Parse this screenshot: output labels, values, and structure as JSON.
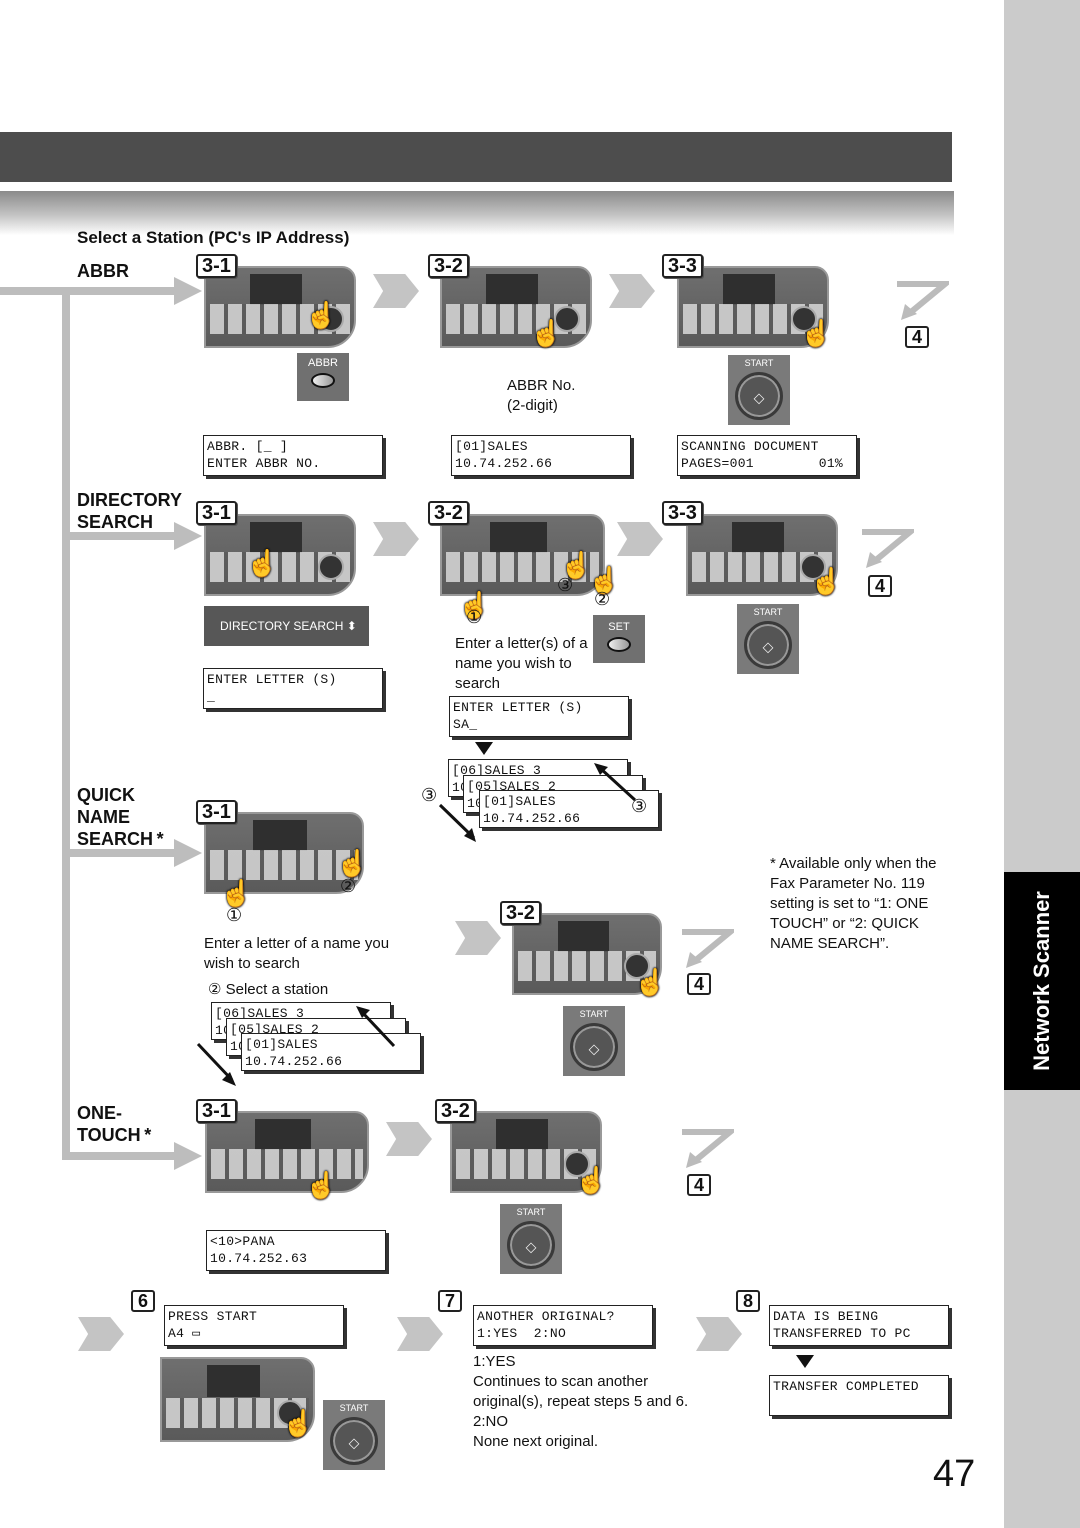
{
  "page": {
    "heading": "Select a Station (PC's IP Address)",
    "page_number": "47",
    "side_tab": "Network Scanner",
    "footnote": "* Available only when the Fax Parameter No. 119 setting is set to “1: ONE TOUCH” or “2: QUICK NAME SEARCH”."
  },
  "methods": {
    "abbr": {
      "label": "ABBR",
      "steps": [
        "3-1",
        "3-2",
        "3-3"
      ],
      "abbr_key": "ABBR",
      "abbr_no_caption": [
        "ABBR No.",
        "(2-digit)"
      ],
      "start_key": "START",
      "lcd": [
        "ABBR. [_ ]\nENTER ABBR NO.",
        "[01]SALES\n10.74.252.66",
        "SCANNING DOCUMENT\nPAGES=001        01%"
      ],
      "next_step": "4"
    },
    "directory": {
      "label": "DIRECTORY\nSEARCH",
      "steps": [
        "3-1",
        "3-2",
        "3-3"
      ],
      "dir_bar": "DIRECTORY SEARCH",
      "set_key": "SET",
      "start_key": "START",
      "caption": "Enter a letter(s) of a name you wish to search",
      "lcd": [
        "ENTER LETTER (S)\n_",
        "ENTER LETTER (S)\nSA_"
      ],
      "stack": [
        "[06]SALES 3\n10",
        "[05]SALES 2\n10",
        "[01]SALES\n10.74.252.66"
      ],
      "markers": [
        "①",
        "②",
        "③"
      ],
      "next_step": "4"
    },
    "quick": {
      "label": "QUICK\nNAME\nSEARCH *",
      "steps": [
        "3-1",
        "3-2"
      ],
      "caption": "Enter a letter of a name you wish to search",
      "select_caption": "② Select a station",
      "stack": [
        "[06]SALES 3\n10",
        "[05]SALES 2\n10",
        "[01]SALES\n10.74.252.66"
      ],
      "markers": [
        "①",
        "②"
      ],
      "start_key": "START",
      "next_step": "4"
    },
    "onetouch": {
      "label": "ONE-\nTOUCH *",
      "steps": [
        "3-1",
        "3-2"
      ],
      "lcd": "<10>PANA\n10.74.252.63",
      "start_key": "START",
      "next_step": "4"
    }
  },
  "final_steps": {
    "s6": {
      "num": "6",
      "lcd": "PRESS START\nA4 ▭",
      "start_key": "START"
    },
    "s7": {
      "num": "7",
      "lcd": "ANOTHER ORIGINAL?\n1:YES  2:NO",
      "desc": [
        "1:YES",
        "Continues to scan another",
        "original(s), repeat steps 5 and 6.",
        "2:NO",
        "None next original."
      ]
    },
    "s8": {
      "num": "8",
      "lcd1": "DATA IS BEING\nTRANSFERRED TO PC",
      "lcd2": "TRANSFER COMPLETED\n "
    }
  }
}
